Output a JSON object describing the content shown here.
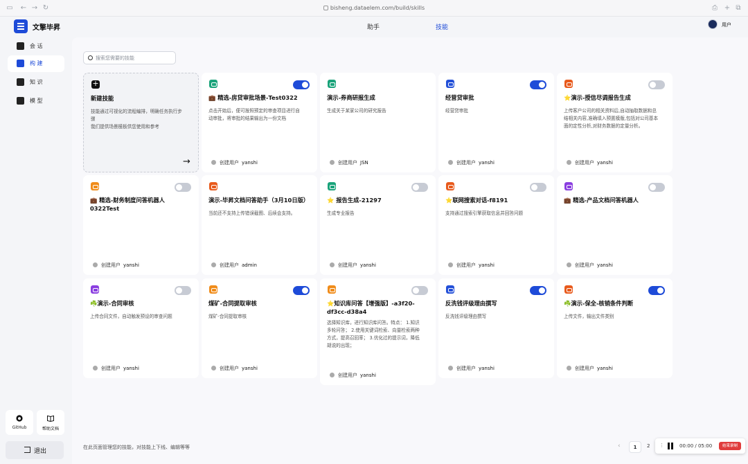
{
  "browser": {
    "url": "bisheng.dataelem.com/build/skills"
  },
  "app": {
    "name": "文擎毕昇"
  },
  "sidebar": {
    "items": [
      {
        "label": "会 话"
      },
      {
        "label": "构 建"
      },
      {
        "label": "知 识"
      },
      {
        "label": "模 型"
      }
    ],
    "github_label": "GitHub",
    "help_label": "帮助文档",
    "logout_label": "退出"
  },
  "topnav": {
    "tabs": [
      {
        "label": "助手"
      },
      {
        "label": "技能"
      }
    ],
    "user_label": "用户"
  },
  "search": {
    "placeholder": "搜索您需要的技能"
  },
  "new_card": {
    "title": "新建技能",
    "desc": "技能通过可视化的流程编排，明确任务执行步骤\n我们提供场景模板供您使用和参考"
  },
  "owner_prefix": "创建用户",
  "cards": [
    {
      "title": "💼 精选-房贷审批场景-Test0322",
      "desc": "点击开始后，便可按照预定的审查项目进行自动审批，将审批的结果输出为一份文档",
      "owner": "yanshi",
      "enabled": true,
      "icon_color": "#1aa37a"
    },
    {
      "title": "演示-券商研报生成",
      "desc": "生成关于某家公司的研究报告",
      "owner": "JSN",
      "enabled": null,
      "icon_color": "#1aa37a"
    },
    {
      "title": "经营贷审批",
      "desc": "经营贷审批",
      "owner": "yanshi",
      "enabled": true,
      "icon_color": "#2350d8"
    },
    {
      "title": "⭐演示-授信尽调报告生成",
      "desc": "上传客户公司的相关资料后,自动抽取数据和总结相关内容,准确填入预置模版,包括对公司基本面的定性分析,对财务数据的定量分析。",
      "owner": "yanshi",
      "enabled": false,
      "icon_color": "#e85a1c"
    },
    {
      "title": "💼 精选-财务制度问答机器人 0322Test",
      "desc": "",
      "owner": "yanshi",
      "enabled": false,
      "icon_color": "#f08c1a"
    },
    {
      "title": "演示-毕昇文档问答助手（3月10日版）",
      "desc": "当前还不支持上传错误截图、后续会支持。",
      "owner": "admin",
      "enabled": null,
      "icon_color": "#e85a1c"
    },
    {
      "title": "⭐ 报告生成-21297",
      "desc": "生成专业报告",
      "owner": "yanshi",
      "enabled": false,
      "icon_color": "#1aa37a"
    },
    {
      "title": "⭐联网搜索对话-f8191",
      "desc": "支持通过搜索引擎获取信息并回答问题",
      "owner": "yanshi",
      "enabled": false,
      "icon_color": "#e85a1c"
    },
    {
      "title": "💼 精选-产品文档问答机器人",
      "desc": "",
      "owner": "yanshi",
      "enabled": false,
      "icon_color": "#8a3ee0"
    },
    {
      "title": "☘️演示-合同审核",
      "desc": "上传合同文件，自动触发预设的审查问题",
      "owner": "yanshi",
      "enabled": false,
      "icon_color": "#8a3ee0"
    },
    {
      "title": "煤矿-合同提取审核",
      "desc": "煤矿-合同提取审核",
      "owner": "yanshi",
      "enabled": true,
      "icon_color": "#f08c1a"
    },
    {
      "title": "⭐知识库问答【增强版】-a3f20-df3cc-d38a4",
      "desc": "选择知识库，进行知识库问答。特点： 1.知识多轮问答； 2.使用关键词检索、向量检索两种方式，提高召回率； 3.优化过的提示词，降低胡说的出现；",
      "owner": "yanshi",
      "enabled": false,
      "icon_color": "#f08c1a"
    },
    {
      "title": "反洗钱评级理由撰写",
      "desc": "反洗钱评级理由撰写",
      "owner": "yanshi",
      "enabled": true,
      "icon_color": "#2350d8"
    },
    {
      "title": "☘️演示-保全-核销条件判断",
      "desc": "上传文件，输出文件类别",
      "owner": "yanshi",
      "enabled": true,
      "icon_color": "#e85a1c"
    }
  ],
  "footer": {
    "note": "在此页面管理您的技能，对技能上下线、编辑等等"
  },
  "pagination": {
    "prev": "‹",
    "current": "1",
    "next_page": "2"
  },
  "recorder": {
    "time": "00:00 / 05:00",
    "stop_label": "结束录制"
  }
}
